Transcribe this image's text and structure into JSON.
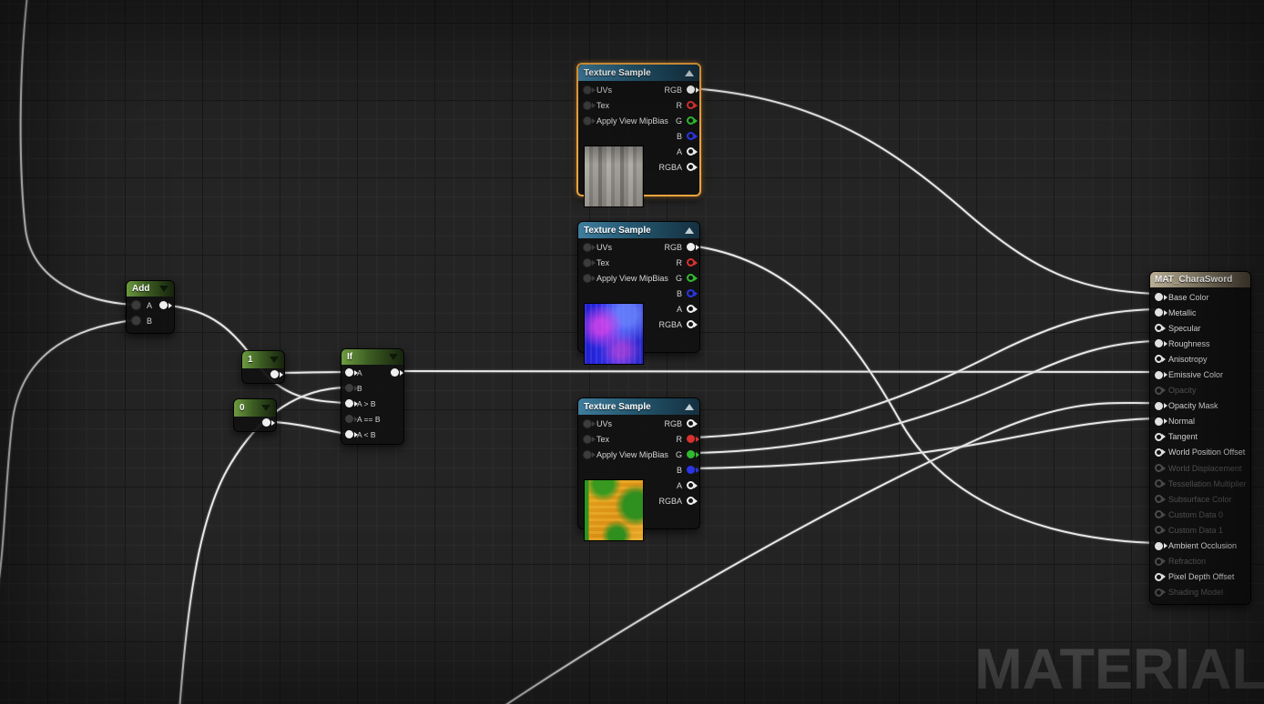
{
  "editor": {
    "watermark": "MATERIAL",
    "wire_color": "#e8e8e8",
    "selection_color": "#eda33f"
  },
  "texture_sample_nodes": [
    {
      "title": "Texture Sample",
      "selected": true,
      "thumb": "grayscale",
      "inputs": [
        {
          "label": "UVs"
        },
        {
          "label": "Tex"
        },
        {
          "label": "Apply View MipBias"
        }
      ],
      "outputs": [
        {
          "label": "RGB",
          "color": "white",
          "connected": true
        },
        {
          "label": "R",
          "color": "red",
          "connected": false
        },
        {
          "label": "G",
          "color": "green",
          "connected": false
        },
        {
          "label": "B",
          "color": "blue",
          "connected": false
        },
        {
          "label": "A",
          "color": "white",
          "connected": false
        },
        {
          "label": "RGBA",
          "color": "white",
          "connected": false
        }
      ]
    },
    {
      "title": "Texture Sample",
      "selected": false,
      "thumb": "normal",
      "inputs": [
        {
          "label": "UVs"
        },
        {
          "label": "Tex"
        },
        {
          "label": "Apply View MipBias"
        }
      ],
      "outputs": [
        {
          "label": "RGB",
          "color": "white",
          "connected": true
        },
        {
          "label": "R",
          "color": "red",
          "connected": false
        },
        {
          "label": "G",
          "color": "green",
          "connected": false
        },
        {
          "label": "B",
          "color": "blue",
          "connected": false
        },
        {
          "label": "A",
          "color": "white",
          "connected": false
        },
        {
          "label": "RGBA",
          "color": "white",
          "connected": false
        }
      ]
    },
    {
      "title": "Texture Sample",
      "selected": false,
      "thumb": "mask",
      "inputs": [
        {
          "label": "UVs"
        },
        {
          "label": "Tex"
        },
        {
          "label": "Apply View MipBias"
        }
      ],
      "outputs": [
        {
          "label": "RGB",
          "color": "white",
          "connected": false
        },
        {
          "label": "R",
          "color": "red",
          "connected": true
        },
        {
          "label": "G",
          "color": "green",
          "connected": true
        },
        {
          "label": "B",
          "color": "blue",
          "connected": true
        },
        {
          "label": "A",
          "color": "white",
          "connected": false
        },
        {
          "label": "RGBA",
          "color": "white",
          "connected": false
        }
      ]
    }
  ],
  "add_node": {
    "title": "Add",
    "inputs": [
      {
        "label": "A"
      },
      {
        "label": "B"
      }
    ]
  },
  "const_nodes": [
    {
      "title": "1"
    },
    {
      "title": "0"
    }
  ],
  "if_node": {
    "title": "If",
    "inputs": [
      {
        "label": "A",
        "connected": true
      },
      {
        "label": "B",
        "connected": false
      },
      {
        "label": "A > B",
        "connected": true
      },
      {
        "label": "A == B",
        "connected": false
      },
      {
        "label": "A < B",
        "connected": true
      }
    ]
  },
  "material_node": {
    "title": "MAT_CharaSword",
    "pins": [
      {
        "label": "Base Color",
        "state": "connected"
      },
      {
        "label": "Metallic",
        "state": "connected"
      },
      {
        "label": "Specular",
        "state": "open"
      },
      {
        "label": "Roughness",
        "state": "connected"
      },
      {
        "label": "Anisotropy",
        "state": "open"
      },
      {
        "label": "Emissive Color",
        "state": "connected"
      },
      {
        "label": "Opacity",
        "state": "disabled"
      },
      {
        "label": "Opacity Mask",
        "state": "connected"
      },
      {
        "label": "Normal",
        "state": "connected"
      },
      {
        "label": "Tangent",
        "state": "open"
      },
      {
        "label": "World Position Offset",
        "state": "open"
      },
      {
        "label": "World Displacement",
        "state": "disabled"
      },
      {
        "label": "Tessellation Multiplier",
        "state": "disabled"
      },
      {
        "label": "Subsurface Color",
        "state": "disabled"
      },
      {
        "label": "Custom Data 0",
        "state": "disabled"
      },
      {
        "label": "Custom Data 1",
        "state": "disabled"
      },
      {
        "label": "Ambient Occlusion",
        "state": "connected"
      },
      {
        "label": "Refraction",
        "state": "disabled"
      },
      {
        "label": "Pixel Depth Offset",
        "state": "open"
      },
      {
        "label": "Shading Model",
        "state": "disabled"
      }
    ]
  },
  "connections": [
    "offscreen-top to Add.A",
    "Add.B from offscreen-left",
    "Add.out to If.A > B",
    "Const 1 to If.A",
    "Const 0 to If.A < B",
    "offscreen-bottom wire passing behind If",
    "If.out to Emissive Color",
    "Texture Sample 1 RGB to Base Color",
    "Texture Sample 2 RGB to Ambient Occlusion",
    "Texture Sample 3 R to Metallic",
    "Texture Sample 3 G to Roughness",
    "Texture Sample 3 B to Normal",
    "offscreen-bottom to Opacity Mask"
  ]
}
